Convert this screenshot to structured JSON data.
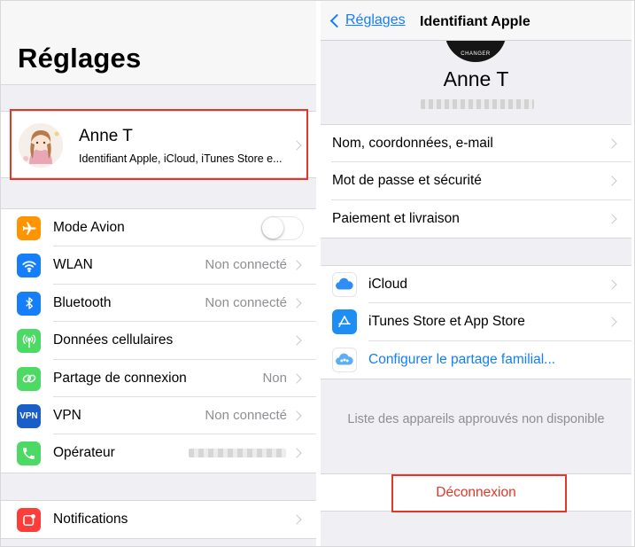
{
  "colors": {
    "accent": "#147efb",
    "danger": "#e0382a",
    "highlight_box": "#e0382a",
    "secondary_text": "#8e8e93",
    "group_bg": "#efeff4"
  },
  "settings": {
    "title": "Réglages",
    "profile": {
      "name": "Anne T",
      "subtitle": "Identifiant Apple, iCloud, iTunes Store e..."
    },
    "group1": [
      {
        "label": "Mode Avion",
        "icon": "airplane-icon",
        "icon_color": "#fe9500",
        "control": "toggle",
        "toggle_on": false
      },
      {
        "label": "WLAN",
        "icon": "wifi-icon",
        "icon_color": "#147efb",
        "value": "Non connecté"
      },
      {
        "label": "Bluetooth",
        "icon": "bluetooth-icon",
        "icon_color": "#147efb",
        "value": "Non connecté"
      },
      {
        "label": "Données cellulaires",
        "icon": "antenna-icon",
        "icon_color": "#4cd964",
        "value": ""
      },
      {
        "label": "Partage de connexion",
        "icon": "link-icon",
        "icon_color": "#4cd964",
        "value": "Non"
      },
      {
        "label": "VPN",
        "icon": "vpn-icon",
        "icon_color": "#1a5ec8",
        "value": "Non connecté",
        "icon_text": "VPN"
      },
      {
        "label": "Opérateur",
        "icon": "phone-icon",
        "icon_color": "#4cd964",
        "value_blurred": true
      }
    ],
    "group2": [
      {
        "label": "Notifications",
        "icon": "notifications-icon",
        "icon_color": "#fc3d39"
      }
    ]
  },
  "apple_id": {
    "back_label": "Réglages",
    "nav_title": "Identifiant Apple",
    "avatar_caption": "CHANGER",
    "name": "Anne T",
    "group1": [
      {
        "label": "Nom, coordonnées, e-mail"
      },
      {
        "label": "Mot de passe et sécurité"
      },
      {
        "label": "Paiement et livraison"
      }
    ],
    "group2": [
      {
        "label": "iCloud",
        "icon": "icloud-icon"
      },
      {
        "label": "iTunes Store et App Store",
        "icon": "app-store-icon"
      },
      {
        "label": "Configurer le partage familial...",
        "icon": "family-sharing-icon",
        "link": true
      }
    ],
    "devices_note": "Liste des appareils approuvés non disponible",
    "logout_label": "Déconnexion"
  }
}
